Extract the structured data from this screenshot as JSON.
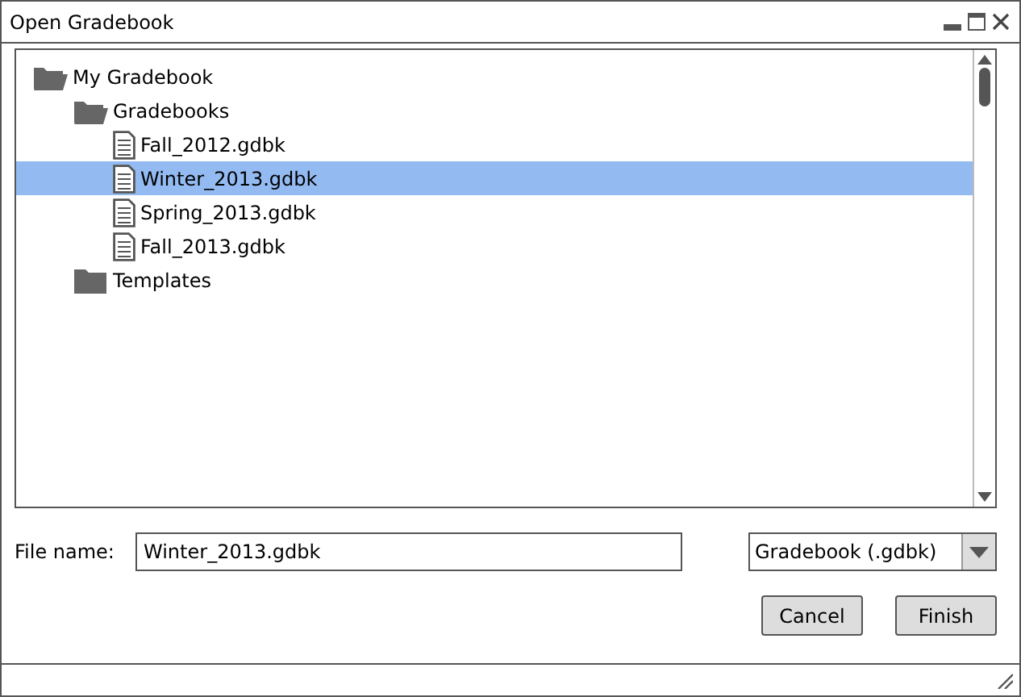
{
  "window": {
    "title": "Open Gradebook"
  },
  "tree": [
    {
      "label": "My Gradebook",
      "kind": "folder",
      "expanded": true,
      "selected": false,
      "children": [
        {
          "label": "Gradebooks",
          "kind": "folder",
          "expanded": true,
          "selected": false,
          "children": [
            {
              "label": "Fall_2012.gdbk",
              "kind": "file",
              "selected": false
            },
            {
              "label": "Winter_2013.gdbk",
              "kind": "file",
              "selected": true
            },
            {
              "label": "Spring_2013.gdbk",
              "kind": "file",
              "selected": false
            },
            {
              "label": "Fall_2013.gdbk",
              "kind": "file",
              "selected": false
            }
          ]
        },
        {
          "label": "Templates",
          "kind": "folder",
          "expanded": false,
          "selected": false
        }
      ]
    }
  ],
  "file_name": {
    "label": "File name:",
    "value": "Winter_2013.gdbk"
  },
  "file_type": {
    "value": "Gradebook (.gdbk)"
  },
  "buttons": [
    "Cancel",
    "Finish"
  ]
}
